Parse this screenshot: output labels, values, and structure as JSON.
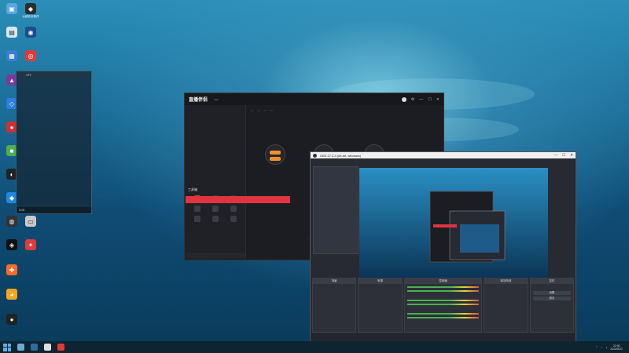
{
  "desktop": {
    "icons": [
      {
        "label": "",
        "color": "#5aa6e0",
        "glyph": "▣"
      },
      {
        "label": "火绒安全软件",
        "color": "#2d2d2d",
        "glyph": "◆"
      },
      {
        "label": "",
        "color": "#d9e6f0",
        "glyph": "▤"
      },
      {
        "label": "",
        "color": "#1d4e8a",
        "glyph": "◉"
      },
      {
        "label": "",
        "color": "#3c7dd0",
        "glyph": "▦"
      },
      {
        "label": "",
        "color": "#e03b3b",
        "glyph": "◎"
      }
    ]
  },
  "chat": {
    "header": [
      "",
      "177"
    ],
    "lines": [
      "",
      "",
      "",
      "",
      "",
      "",
      "",
      "",
      "",
      "",
      "",
      "",
      ""
    ],
    "footer": "3.19"
  },
  "app": {
    "logo": "直播伴侣",
    "badge": "",
    "tabs": [
      "",
      "",
      ""
    ],
    "main_title": "",
    "chips": [
      "",
      "",
      "",
      ""
    ],
    "tools_label": "工具箱",
    "tools": [
      "",
      "",
      "",
      "",
      "",
      "",
      "",
      "",
      ""
    ],
    "red_banner": "",
    "status": "",
    "bottom_actions": [
      "",
      ""
    ]
  },
  "obs": {
    "title": "OBS 27.2.4 (64-bit, windows)",
    "menu": [
      "",
      "",
      "",
      "",
      "",
      "",
      ""
    ],
    "docks": {
      "scenes": {
        "title": "场景",
        "items": [
          "",
          "",
          "",
          ""
        ]
      },
      "sources": {
        "title": "来源",
        "items": [
          ""
        ]
      },
      "mixer": {
        "title": "混音器"
      },
      "transitions": {
        "title": "转场特效"
      },
      "controls": {
        "title": "控件",
        "buttons": [
          "",
          "",
          "",
          "",
          "设置",
          "退出"
        ]
      }
    },
    "status": [
      "",
      "",
      ""
    ]
  },
  "taskbar": {
    "time": "22:00",
    "date": "2022/5/21"
  }
}
